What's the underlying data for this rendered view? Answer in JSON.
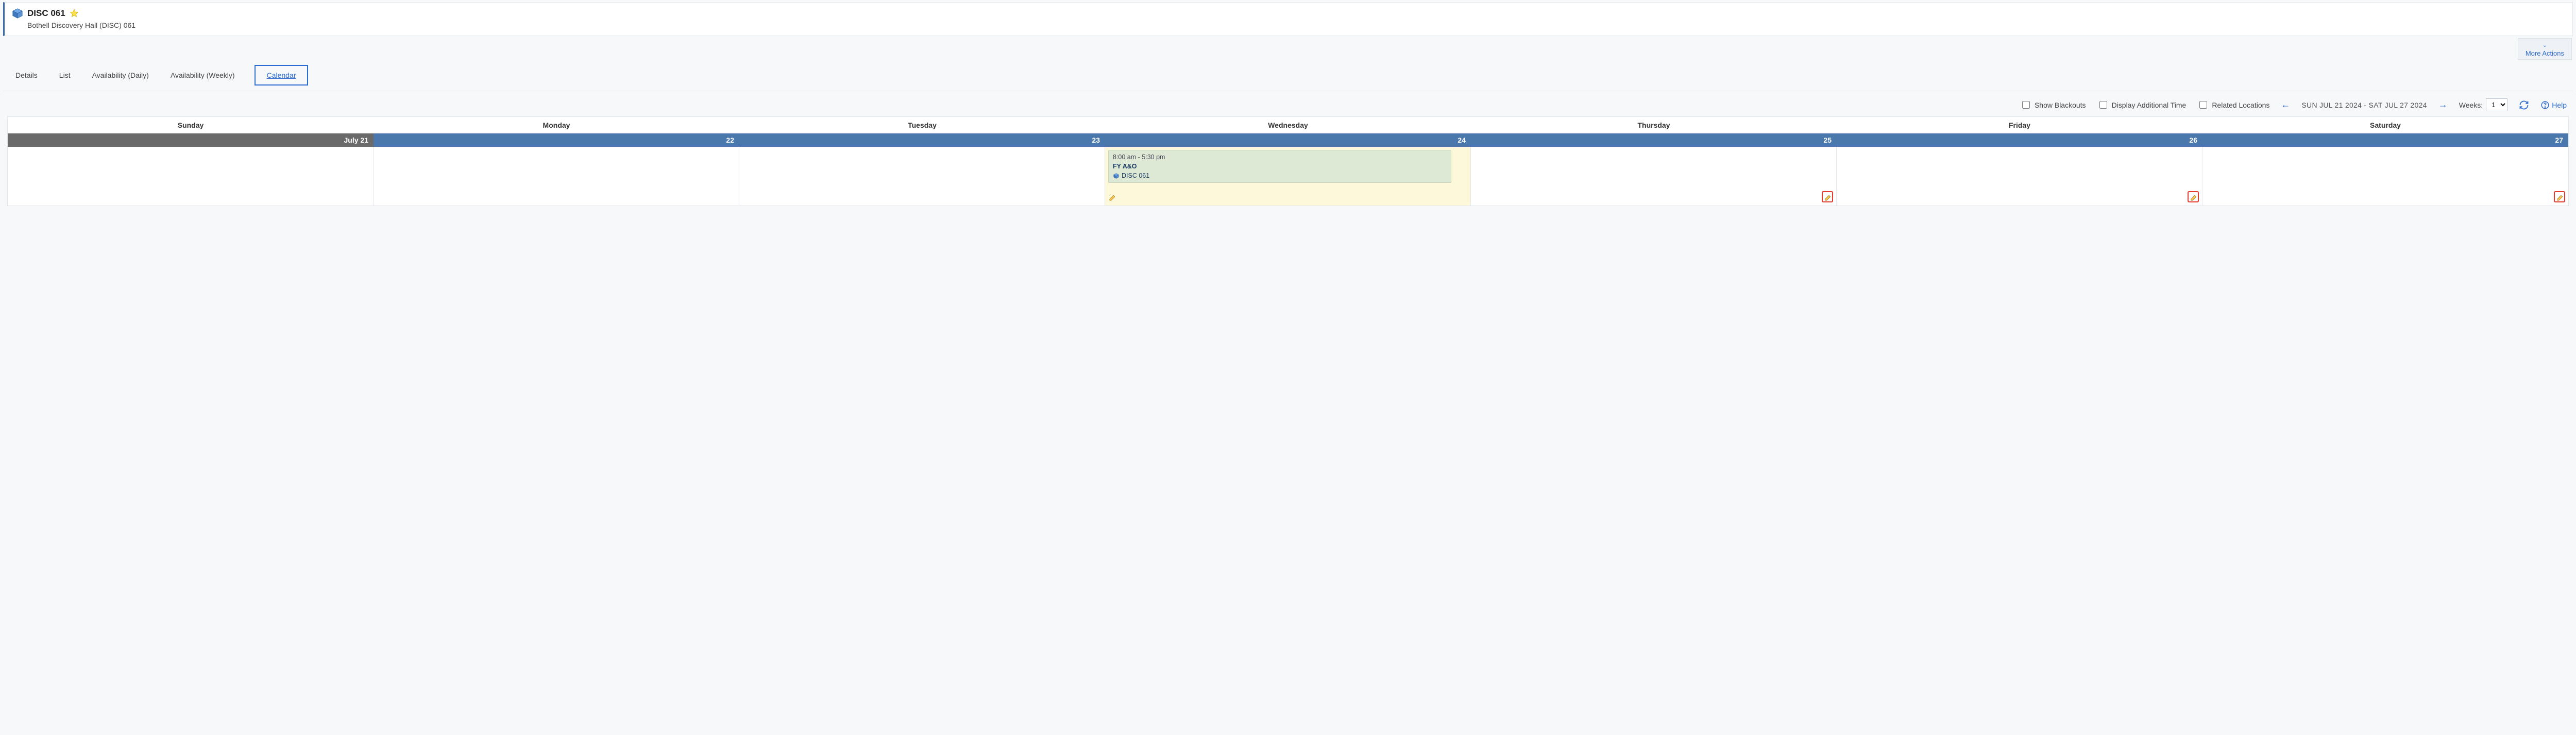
{
  "header": {
    "title": "DISC 061",
    "subtitle": "Bothell Discovery Hall (DISC) 061",
    "more_actions": "More Actions"
  },
  "tabs": {
    "details": "Details",
    "list": "List",
    "avail_daily": "Availability (Daily)",
    "avail_weekly": "Availability (Weekly)",
    "calendar": "Calendar"
  },
  "toolbar": {
    "show_blackouts": "Show Blackouts",
    "display_additional": "Display Additional Time",
    "related_locations": "Related Locations",
    "date_range": "SUN JUL 21 2024 - SAT JUL 27 2024",
    "weeks_label": "Weeks:",
    "weeks_value": "1",
    "help": "Help"
  },
  "calendar": {
    "days": {
      "sun": "Sunday",
      "mon": "Monday",
      "tue": "Tuesday",
      "wed": "Wednesday",
      "thu": "Thursday",
      "fri": "Friday",
      "sat": "Saturday"
    },
    "dates": {
      "sun": "July 21",
      "mon": "22",
      "tue": "23",
      "wed": "24",
      "thu": "25",
      "fri": "26",
      "sat": "27"
    },
    "event": {
      "time": "8:00 am - 5:30 pm",
      "title": "FY A&O",
      "location": "DISC 061"
    }
  }
}
